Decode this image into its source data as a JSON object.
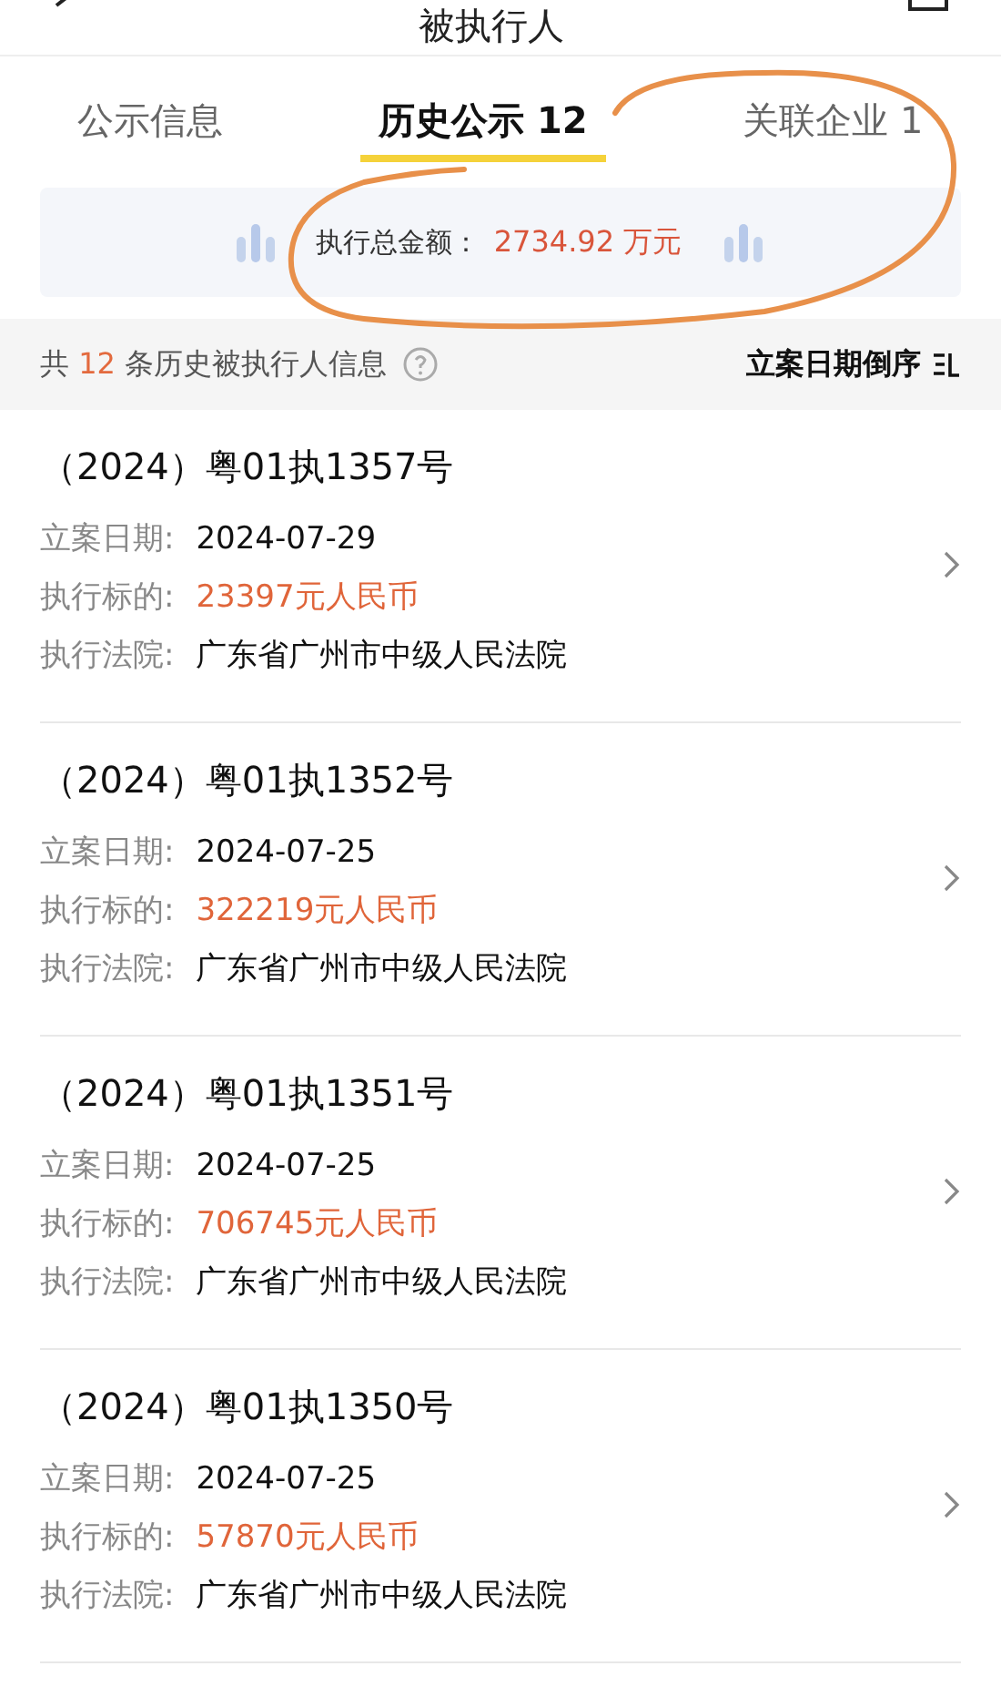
{
  "header": {
    "title": "被执行人"
  },
  "tabs": [
    {
      "label": "公示信息",
      "selected": false
    },
    {
      "label": "历史公示 12",
      "selected": true
    },
    {
      "label": "关联企业 1",
      "selected": false
    }
  ],
  "summary": {
    "label": "执行总金额：",
    "value": "2734.92 万元"
  },
  "list_info": {
    "prefix": "共",
    "count": "12",
    "suffix": "条历史被执行人信息",
    "sort_label": "立案日期倒序"
  },
  "records": [
    {
      "case_no": "（2024）粤01执1357号",
      "fields": [
        {
          "label": "立案日期:",
          "value": "2024-07-29",
          "kind": "plain"
        },
        {
          "label": "执行标的:",
          "value": "23397元人民币",
          "kind": "amount"
        },
        {
          "label": "执行法院:",
          "value": "广东省广州市中级人民法院",
          "kind": "plain"
        }
      ]
    },
    {
      "case_no": "（2024）粤01执1352号",
      "fields": [
        {
          "label": "立案日期:",
          "value": "2024-07-25",
          "kind": "plain"
        },
        {
          "label": "执行标的:",
          "value": "322219元人民币",
          "kind": "amount"
        },
        {
          "label": "执行法院:",
          "value": "广东省广州市中级人民法院",
          "kind": "plain"
        }
      ]
    },
    {
      "case_no": "（2024）粤01执1351号",
      "fields": [
        {
          "label": "立案日期:",
          "value": "2024-07-25",
          "kind": "plain"
        },
        {
          "label": "执行标的:",
          "value": "706745元人民币",
          "kind": "amount"
        },
        {
          "label": "执行法院:",
          "value": "广东省广州市中级人民法院",
          "kind": "plain"
        }
      ]
    },
    {
      "case_no": "（2024）粤01执1350号",
      "fields": [
        {
          "label": "立案日期:",
          "value": "2024-07-25",
          "kind": "plain"
        },
        {
          "label": "执行标的:",
          "value": "57870元人民币",
          "kind": "amount"
        },
        {
          "label": "执行法院:",
          "value": "广东省广州市中级人民法院",
          "kind": "plain"
        }
      ]
    }
  ]
}
